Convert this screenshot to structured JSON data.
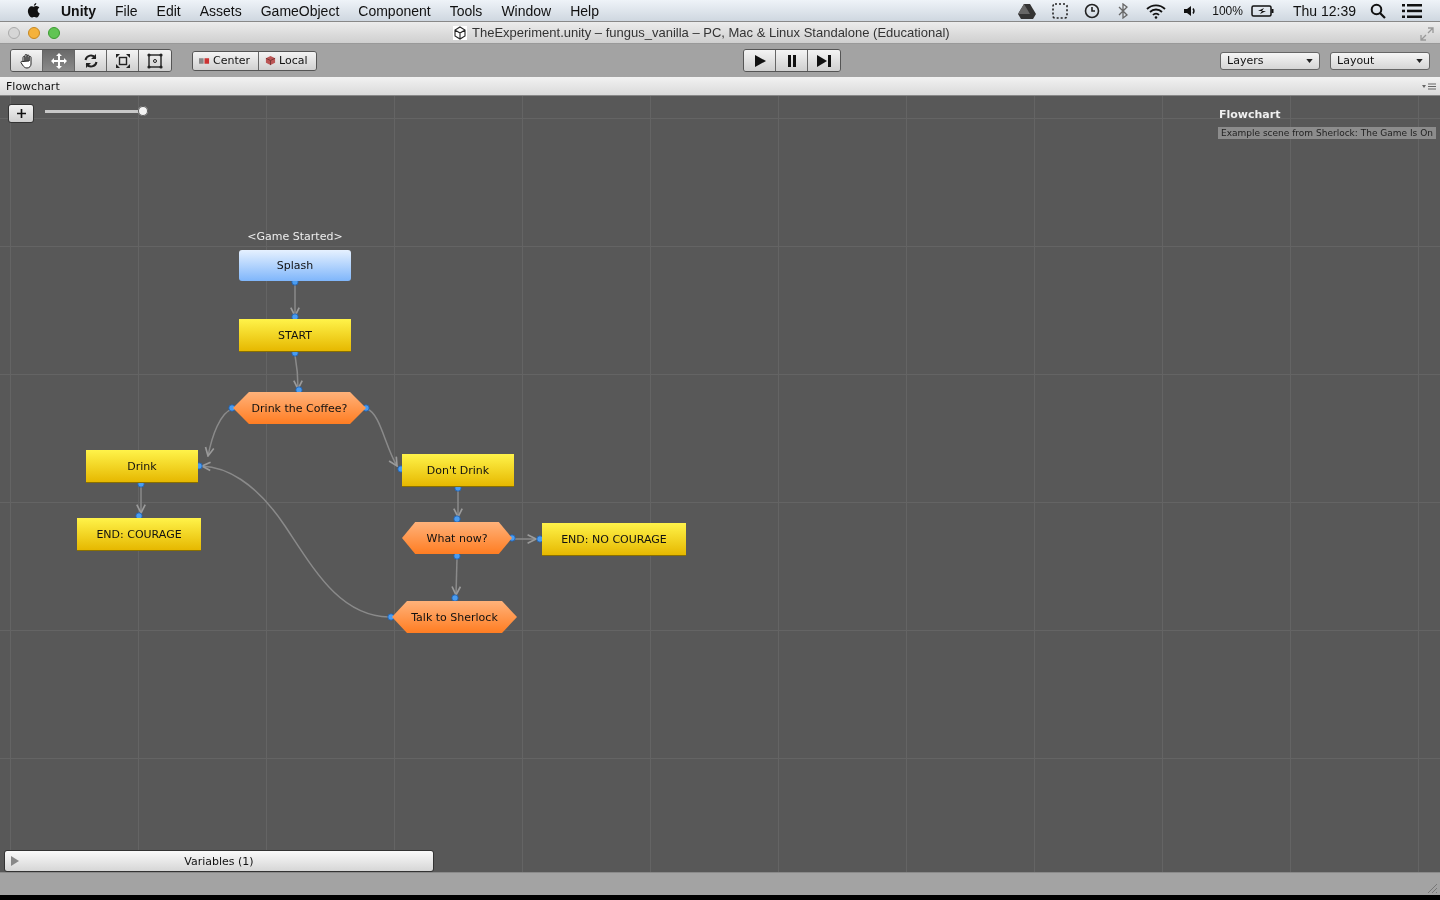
{
  "menubar": {
    "app": "Unity",
    "menus": [
      "File",
      "Edit",
      "Assets",
      "GameObject",
      "Component",
      "Tools",
      "Window",
      "Help"
    ],
    "battery": "100%",
    "clock": "Thu 12:39"
  },
  "window": {
    "title": "TheExperiment.unity – fungus_vanilla – PC, Mac & Linux Standalone (Educational)"
  },
  "toolbar": {
    "tools": [
      {
        "kind": "hand",
        "selected": false
      },
      {
        "kind": "move",
        "selected": true
      },
      {
        "kind": "rotate",
        "selected": false
      },
      {
        "kind": "scale",
        "selected": false
      },
      {
        "kind": "rect",
        "selected": false
      }
    ],
    "pivot": [
      {
        "kind": "center",
        "label": "Center"
      },
      {
        "kind": "local",
        "label": "Local"
      }
    ],
    "playback": [
      {
        "kind": "play"
      },
      {
        "kind": "pause"
      },
      {
        "kind": "step"
      }
    ],
    "dropdowns": [
      "Layers",
      "Layout"
    ]
  },
  "panel": {
    "tab": "Flowchart",
    "zoom": {
      "level": 1
    },
    "info": {
      "title": "Flowchart",
      "description": "Example scene from Sherlock: The Game Is On"
    },
    "nodes": [
      {
        "label": "Splash",
        "kind": "event",
        "event": "<Game Started>"
      },
      {
        "label": "START",
        "kind": "block"
      },
      {
        "label": "Drink the Coffee?",
        "kind": "choice"
      },
      {
        "label": "Drink",
        "kind": "block"
      },
      {
        "label": "END: COURAGE",
        "kind": "block"
      },
      {
        "label": "Don't Drink",
        "kind": "block"
      },
      {
        "label": "What now?",
        "kind": "choice"
      },
      {
        "label": "END: NO COURAGE",
        "kind": "block"
      },
      {
        "label": "Talk to Sherlock",
        "kind": "choice"
      }
    ],
    "variables": {
      "label": "Variables (1)",
      "expanded": false
    }
  }
}
